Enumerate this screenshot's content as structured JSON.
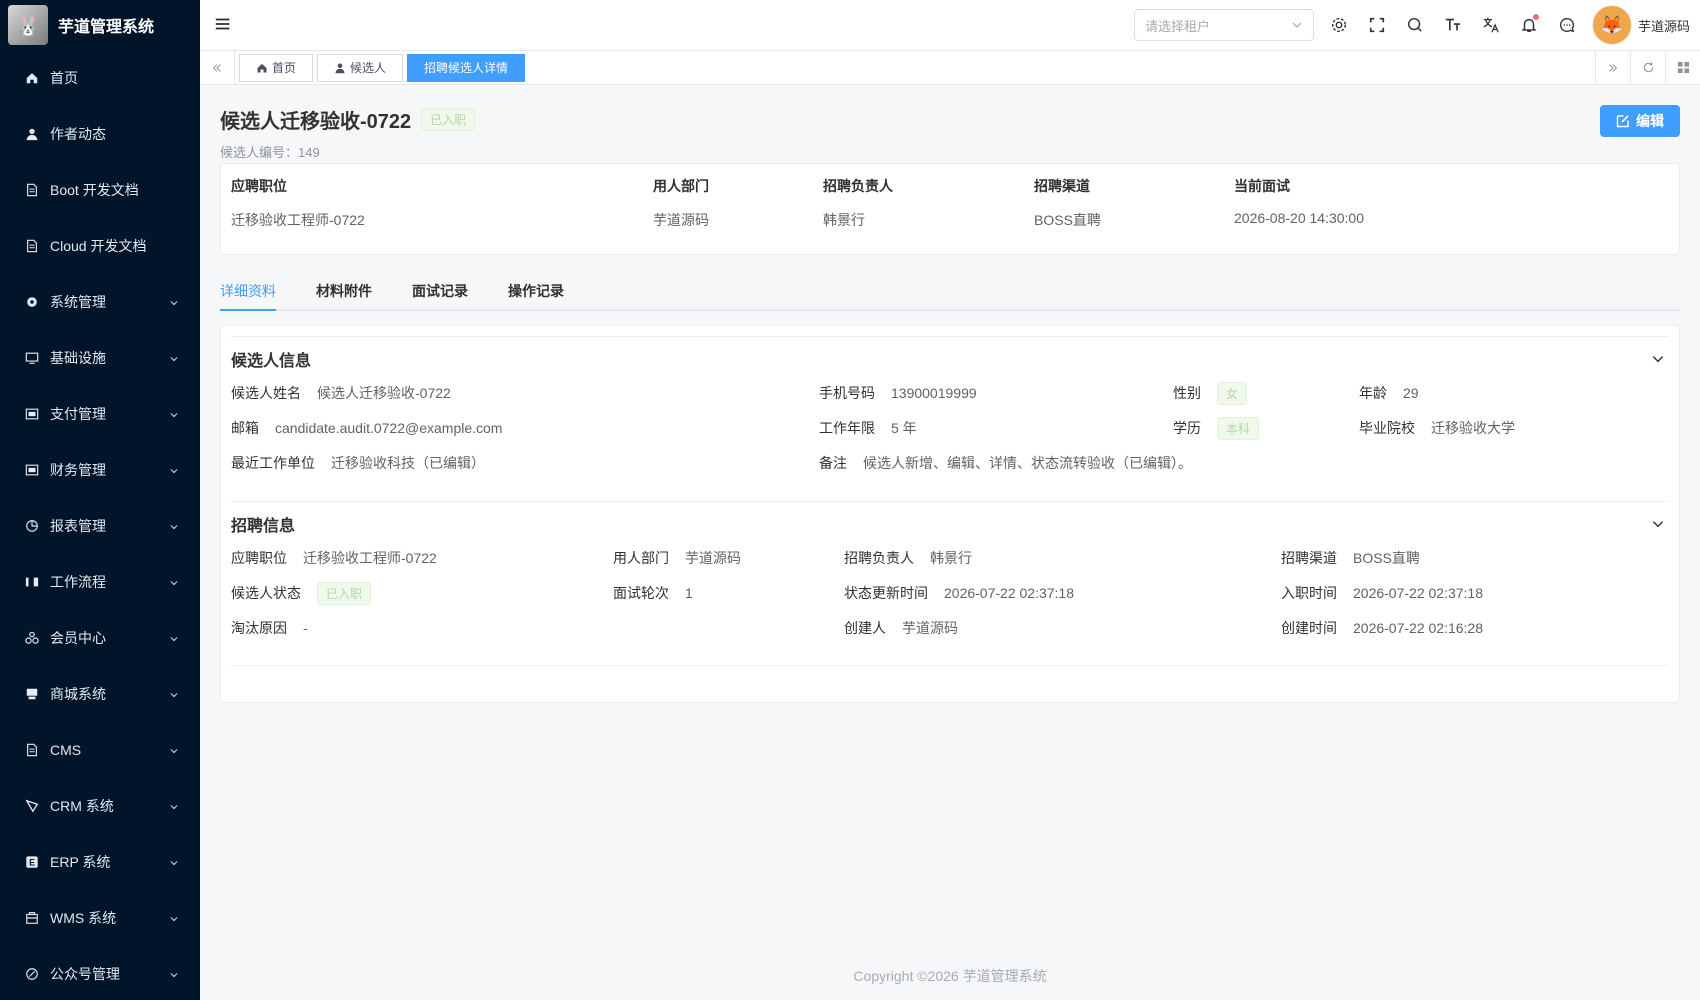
{
  "app": {
    "title": "芋道管理系统",
    "copyright": "Copyright ©2026 芋道管理系统"
  },
  "sidebar": {
    "items": [
      {
        "label": "首页",
        "icon": "home-icon",
        "expandable": false
      },
      {
        "label": "作者动态",
        "icon": "user-icon",
        "expandable": false
      },
      {
        "label": "Boot 开发文档",
        "icon": "document-icon",
        "expandable": false
      },
      {
        "label": "Cloud 开发文档",
        "icon": "document-icon",
        "expandable": false
      },
      {
        "label": "系统管理",
        "icon": "gear-icon",
        "expandable": true
      },
      {
        "label": "基础设施",
        "icon": "monitor-icon",
        "expandable": true
      },
      {
        "label": "支付管理",
        "icon": "payment-icon",
        "expandable": true
      },
      {
        "label": "财务管理",
        "icon": "finance-icon",
        "expandable": true
      },
      {
        "label": "报表管理",
        "icon": "report-icon",
        "expandable": true
      },
      {
        "label": "工作流程",
        "icon": "workflow-icon",
        "expandable": true
      },
      {
        "label": "会员中心",
        "icon": "member-icon",
        "expandable": true
      },
      {
        "label": "商城系统",
        "icon": "shop-icon",
        "expandable": true
      },
      {
        "label": "CMS",
        "icon": "cms-icon",
        "expandable": true
      },
      {
        "label": "CRM 系统",
        "icon": "crm-icon",
        "expandable": true
      },
      {
        "label": "ERP 系统",
        "icon": "erp-icon",
        "expandable": true
      },
      {
        "label": "WMS 系统",
        "icon": "wms-icon",
        "expandable": true
      },
      {
        "label": "公众号管理",
        "icon": "wechat-icon",
        "expandable": true
      }
    ]
  },
  "header": {
    "tenant_placeholder": "请选择租户",
    "user_name": "芋道源码"
  },
  "tags": [
    {
      "label": "首页",
      "icon": "home-icon",
      "active": false
    },
    {
      "label": "候选人",
      "icon": "user-icon",
      "active": false
    },
    {
      "label": "招聘候选人详情",
      "icon": "",
      "active": true
    }
  ],
  "candidate": {
    "name": "候选人迁移验收-0722",
    "status_badge": "已入职",
    "number_label": "候选人编号：",
    "number": "149",
    "edit_label": "编辑"
  },
  "summary": {
    "columns": [
      {
        "label": "应聘职位",
        "value": "迁移验收工程师-0722"
      },
      {
        "label": "用人部门",
        "value": "芋道源码"
      },
      {
        "label": "招聘负责人",
        "value": "韩景行"
      },
      {
        "label": "招聘渠道",
        "value": "BOSS直聘"
      },
      {
        "label": "当前面试",
        "value": "2026-08-20 14:30:00"
      }
    ]
  },
  "tabs": [
    {
      "label": "详细资料",
      "active": true
    },
    {
      "label": "材料附件",
      "active": false
    },
    {
      "label": "面试记录",
      "active": false
    },
    {
      "label": "操作记录",
      "active": false
    }
  ],
  "candidate_info": {
    "title": "候选人信息",
    "name_label": "候选人姓名",
    "name_value": "候选人迁移验收-0722",
    "phone_label": "手机号码",
    "phone_value": "13900019999",
    "gender_label": "性别",
    "gender_value": "女",
    "age_label": "年龄",
    "age_value": "29",
    "email_label": "邮箱",
    "email_value": "candidate.audit.0722@example.com",
    "years_label": "工作年限",
    "years_value": "5 年",
    "edu_label": "学历",
    "edu_value": "本科",
    "school_label": "毕业院校",
    "school_value": "迁移验收大学",
    "company_label": "最近工作单位",
    "company_value": "迁移验收科技（已编辑）",
    "remark_label": "备注",
    "remark_value": "候选人新增、编辑、详情、状态流转验收（已编辑）。"
  },
  "recruit_info": {
    "title": "招聘信息",
    "position_label": "应聘职位",
    "position_value": "迁移验收工程师-0722",
    "dept_label": "用人部门",
    "dept_value": "芋道源码",
    "owner_label": "招聘负责人",
    "owner_value": "韩景行",
    "channel_label": "招聘渠道",
    "channel_value": "BOSS直聘",
    "status_label": "候选人状态",
    "status_value": "已入职",
    "round_label": "面试轮次",
    "round_value": "1",
    "updated_label": "状态更新时间",
    "updated_value": "2026-07-22 02:37:18",
    "onboard_label": "入职时间",
    "onboard_value": "2026-07-22 02:37:18",
    "reject_label": "淘汰原因",
    "reject_value": "-",
    "creator_label": "创建人",
    "creator_value": "芋道源码",
    "created_label": "创建时间",
    "created_value": "2026-07-22 02:16:28"
  }
}
